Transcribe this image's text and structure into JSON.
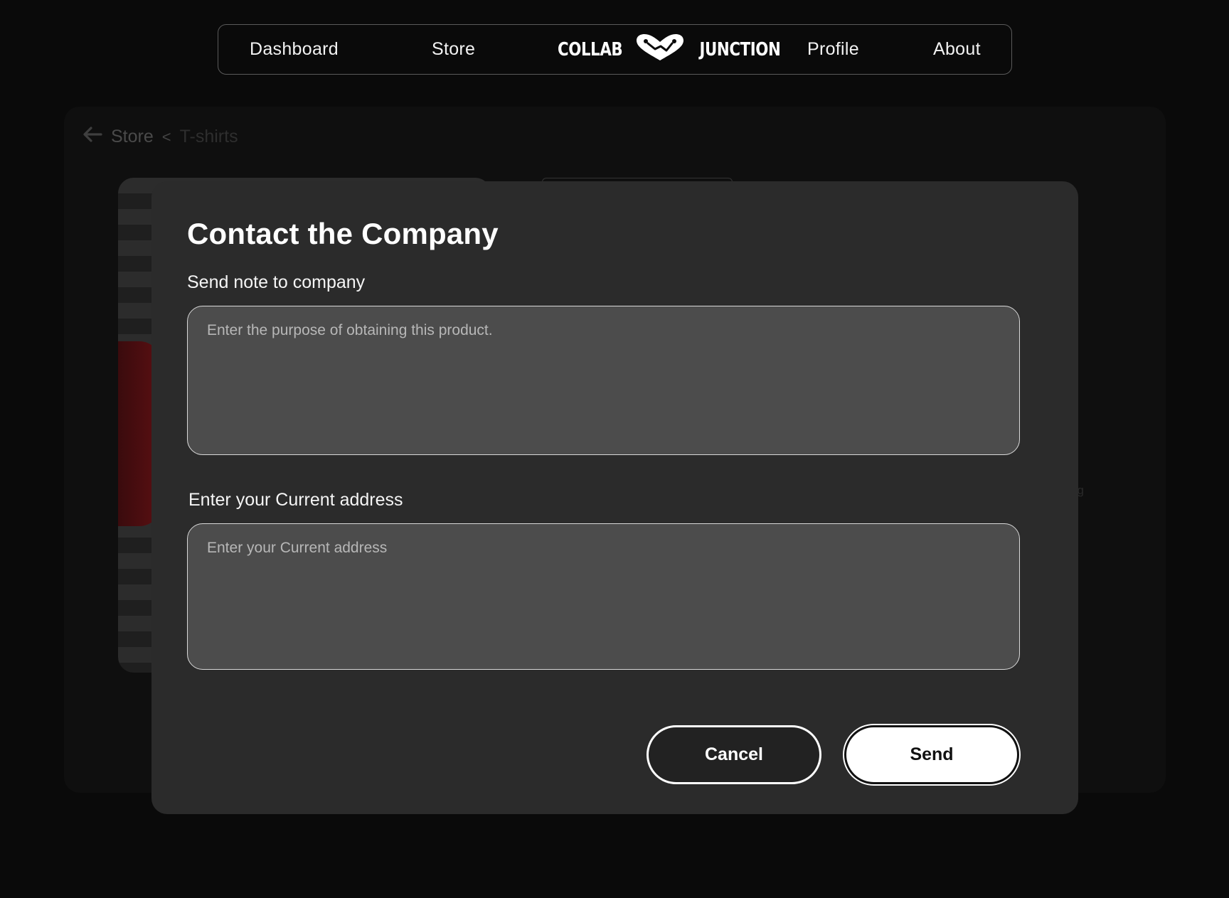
{
  "nav": {
    "dashboard": "Dashboard",
    "store": "Store",
    "logo_left": "COLLAB",
    "logo_right": "JUNCTION",
    "profile": "Profile",
    "about": "About"
  },
  "breadcrumb": {
    "store": "Store",
    "separator": "<",
    "current": "T-shirts"
  },
  "background": {
    "faded_text": "ng"
  },
  "modal": {
    "title": "Contact the Company",
    "note_label": "Send note to company",
    "note_placeholder": "Enter the purpose of obtaining this product.",
    "note_value": "",
    "address_label": "Enter your Current address",
    "address_placeholder": "Enter your Current address",
    "address_value": "",
    "cancel_label": "Cancel",
    "send_label": "Send"
  },
  "colors": {
    "page_bg": "#0a0a0a",
    "modal_bg": "#2b2b2b",
    "input_bg": "#4c4c4c",
    "accent": "#ffffff"
  }
}
